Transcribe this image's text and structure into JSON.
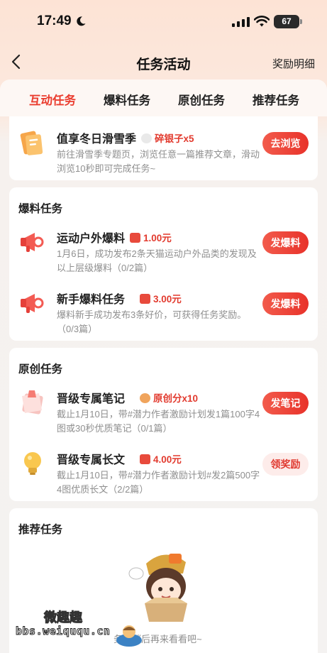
{
  "status_bar": {
    "time": "17:49",
    "battery": "67"
  },
  "nav": {
    "title": "任务活动",
    "right_link": "奖励明细"
  },
  "tabs": [
    {
      "label": "互动任务",
      "active": true
    },
    {
      "label": "爆料任务",
      "active": false
    },
    {
      "label": "原创任务",
      "active": false
    },
    {
      "label": "推荐任务",
      "active": false
    }
  ],
  "interactive": {
    "task": {
      "title": "值享冬日滑雪季",
      "reward": "碎银子x5",
      "desc": "前往滑雪季专题页，浏览任意一篇推荐文章，滑动浏览10秒即可完成任务~",
      "button": "去浏览"
    }
  },
  "tip_off": {
    "title": "爆料任务",
    "tasks": [
      {
        "title": "运动户外爆料",
        "reward": "1.00元",
        "desc": "1月6日，成功发布2条天猫运动户外品类的发现及以上层级爆料（0/2篇）",
        "button": "发爆料"
      },
      {
        "title": "新手爆料任务",
        "reward": "3.00元",
        "desc": "爆料新手成功发布3条好价，可获得任务奖励。（0/3篇）",
        "button": "发爆料"
      }
    ]
  },
  "original": {
    "title": "原创任务",
    "tasks": [
      {
        "title": "晋级专属笔记",
        "reward": "原创分x10",
        "desc": "截止1月10日，带#潜力作者激励计划发1篇100字4图或30秒优质笔记（0/1篇）",
        "button": "发笔记"
      },
      {
        "title": "晋级专属长文",
        "reward": "4.00元",
        "desc": "截止1月10日，带#潜力作者激励计划#发2篇500字4图优质长文（2/2篇）",
        "button": "领奖励"
      }
    ]
  },
  "recommend": {
    "title": "推荐任务",
    "empty_text": "务，稍后再来看看吧~"
  },
  "watermark": {
    "line1": "微趣趣",
    "line2": "bbs.weiququ.cn"
  },
  "colors": {
    "accent": "#ea3c2e",
    "button_start": "#f25b4c",
    "button_end": "#e8322a"
  }
}
